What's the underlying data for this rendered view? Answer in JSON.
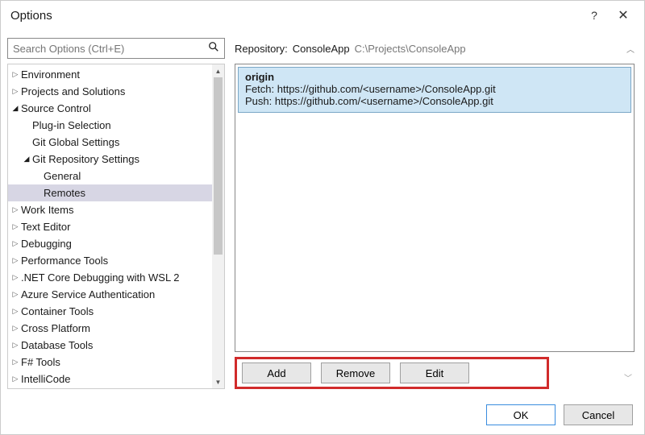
{
  "window": {
    "title": "Options",
    "help_label": "?",
    "close_label": "✕"
  },
  "search": {
    "placeholder": "Search Options (Ctrl+E)",
    "value": ""
  },
  "tree": {
    "env": "Environment",
    "proj": "Projects and Solutions",
    "scc": "Source Control",
    "scc_plugin": "Plug-in Selection",
    "scc_global": "Git Global Settings",
    "scc_repo": "Git Repository Settings",
    "scc_repo_general": "General",
    "scc_repo_remotes": "Remotes",
    "workitems": "Work Items",
    "texteditor": "Text Editor",
    "debugging": "Debugging",
    "perf": "Performance Tools",
    "wsl": ".NET Core Debugging with WSL 2",
    "azure": "Azure Service Authentication",
    "container": "Container Tools",
    "cross": "Cross Platform",
    "db": "Database Tools",
    "fsharp": "F# Tools",
    "intellicode": "IntelliCode"
  },
  "repo": {
    "label": "Repository:",
    "name": "ConsoleApp",
    "path": "C:\\Projects\\ConsoleApp"
  },
  "remote": {
    "name": "origin",
    "fetch_lbl": "Fetch:",
    "fetch_url": "https://github.com/<username>/ConsoleApp.git",
    "push_lbl": "Push:",
    "push_url": "https://github.com/<username>/ConsoleApp.git"
  },
  "buttons": {
    "add": "Add",
    "remove": "Remove",
    "edit": "Edit",
    "ok": "OK",
    "cancel": "Cancel"
  }
}
